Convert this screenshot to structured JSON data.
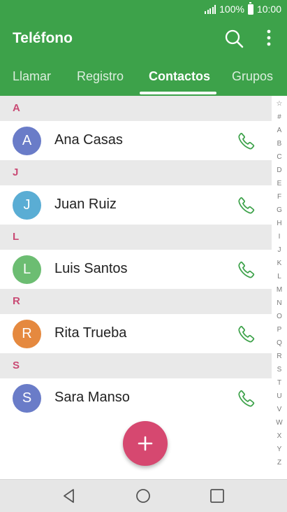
{
  "status_bar": {
    "battery": "100%",
    "time": "10:00"
  },
  "app_bar": {
    "title": "Teléfono",
    "icons": [
      "search-icon",
      "more-vert-icon"
    ]
  },
  "tabs": [
    {
      "label": "Llamar",
      "active": false
    },
    {
      "label": "Registro",
      "active": false
    },
    {
      "label": "Contactos",
      "active": true
    },
    {
      "label": "Grupos",
      "active": false
    }
  ],
  "contacts": [
    {
      "section": "A",
      "initial": "A",
      "name": "Ana Casas",
      "color": "#6a7cc8"
    },
    {
      "section": "J",
      "initial": "J",
      "name": "Juan Ruiz",
      "color": "#5aadd4"
    },
    {
      "section": "L",
      "initial": "L",
      "name": "Luis Santos",
      "color": "#6cbd72"
    },
    {
      "section": "R",
      "initial": "R",
      "name": "Rita Trueba",
      "color": "#e5893f"
    },
    {
      "section": "S",
      "initial": "S",
      "name": "Sara Manso",
      "color": "#6a7cc8"
    }
  ],
  "index_letters": [
    "☆",
    "#",
    "A",
    "B",
    "C",
    "D",
    "E",
    "F",
    "G",
    "H",
    "I",
    "J",
    "K",
    "L",
    "M",
    "N",
    "O",
    "P",
    "Q",
    "R",
    "S",
    "T",
    "U",
    "V",
    "W",
    "X",
    "Y",
    "Z"
  ],
  "colors": {
    "primary": "#3da24a",
    "accent": "#d64870",
    "section_letter": "#c94a74",
    "call_icon": "#3da24a"
  },
  "fab": {
    "icon": "plus-icon"
  },
  "nav_bar": {
    "icons": [
      "back-icon",
      "home-icon",
      "recents-icon"
    ]
  }
}
